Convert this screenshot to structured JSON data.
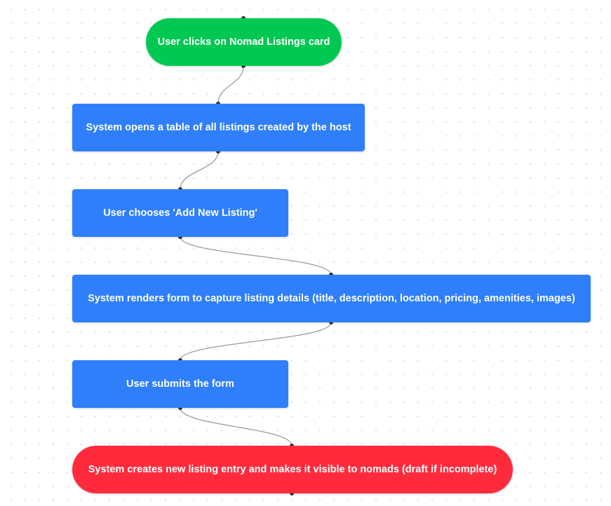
{
  "colors": {
    "start": "#00c853",
    "step": "#2f7ffb",
    "end": "#ff2b3d",
    "edge": "#9b9b9b",
    "handle": "#333333"
  },
  "nodes": [
    {
      "id": "n1",
      "kind": "start",
      "label": "User clicks on Nomad Listings card"
    },
    {
      "id": "n2",
      "kind": "step",
      "label": "System opens a table of all listings created by the host"
    },
    {
      "id": "n3",
      "kind": "step",
      "label": "User chooses 'Add New Listing'"
    },
    {
      "id": "n4",
      "kind": "step",
      "label": "System renders form to capture listing details (title, description, location, pricing, amenities, images)"
    },
    {
      "id": "n5",
      "kind": "step",
      "label": "User submits the form"
    },
    {
      "id": "n6",
      "kind": "end",
      "label": "System creates new listing entry and makes it visible to nomads (draft if incomplete)"
    }
  ],
  "edges": [
    {
      "from": "n1",
      "to": "n2"
    },
    {
      "from": "n2",
      "to": "n3"
    },
    {
      "from": "n3",
      "to": "n4"
    },
    {
      "from": "n4",
      "to": "n5"
    },
    {
      "from": "n5",
      "to": "n6"
    }
  ]
}
